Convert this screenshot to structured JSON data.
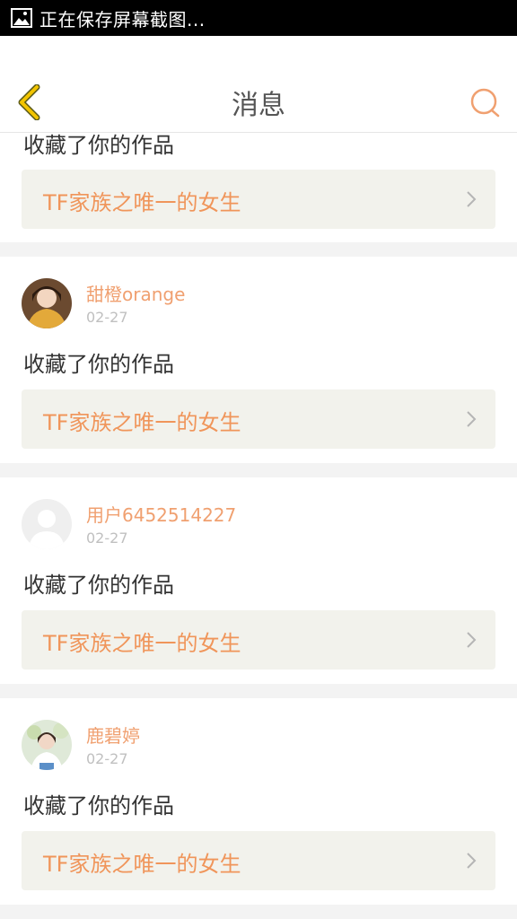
{
  "status_bar": {
    "text": "正在保存屏幕截图..."
  },
  "header": {
    "title": "消息"
  },
  "partial_item": {
    "action": "收藏了你的作品",
    "work_title": "TF家族之唯一的女生"
  },
  "items": [
    {
      "username": "甜橙orange",
      "date": "02-27",
      "action": "收藏了你的作品",
      "work_title": "TF家族之唯一的女生"
    },
    {
      "username": "用户6452514227",
      "date": "02-27",
      "action": "收藏了你的作品",
      "work_title": "TF家族之唯一的女生"
    },
    {
      "username": "鹿碧婷",
      "date": "02-27",
      "action": "收藏了你的作品",
      "work_title": "TF家族之唯一的女生"
    }
  ],
  "colors": {
    "accent": "#f0955a",
    "username": "#f0a070",
    "back_icon": "#f2b400",
    "search_icon": "#f0a070"
  },
  "icons": {
    "back": "chevron-left-icon",
    "search": "search-icon",
    "status": "image-icon",
    "link": "chevron-right-icon"
  }
}
